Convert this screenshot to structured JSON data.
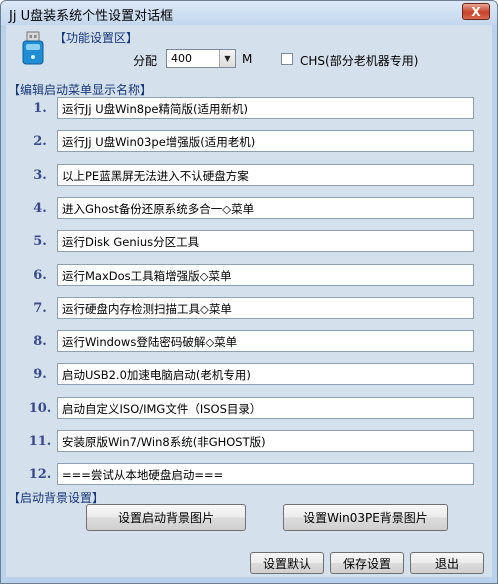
{
  "window": {
    "title": "Jj U盘装系统个性设置对话框",
    "close_glyph": "X"
  },
  "function_area": {
    "title": "【功能设置区】",
    "alloc_label": "分配",
    "alloc_value": "400",
    "alloc_unit": "M",
    "chs_label": "CHS(部分老机器专用)",
    "chs_checked": false
  },
  "menu_section": {
    "title": "【编辑启动菜单显示名称】",
    "items": [
      {
        "num": "1.",
        "text": "运行Jj U盘Win8pe精简版(适用新机)"
      },
      {
        "num": "2.",
        "text": "运行Jj U盘Win03pe增强版(适用老机)"
      },
      {
        "num": "3.",
        "text": "以上PE蓝黑屏无法进入不认硬盘方案"
      },
      {
        "num": "4.",
        "text": "进入Ghost备份还原系统多合一◇菜单"
      },
      {
        "num": "5.",
        "text": "运行Disk Genius分区工具"
      },
      {
        "num": "6.",
        "text": "运行MaxDos工具箱增强版◇菜单"
      },
      {
        "num": "7.",
        "text": "运行硬盘内存检测扫描工具◇菜单"
      },
      {
        "num": "8.",
        "text": "运行Windows登陆密码破解◇菜单"
      },
      {
        "num": "9.",
        "text": "启动USB2.0加速电脑启动(老机专用)"
      },
      {
        "num": "10.",
        "text": "启动自定义ISO/IMG文件（ISOS目录）"
      },
      {
        "num": "11.",
        "text": "安装原版Win7/Win8系统(非GHOST版)"
      },
      {
        "num": "12.",
        "text": "===尝试从本地硬盘启动==="
      }
    ]
  },
  "background_section": {
    "title": "【启动背景设置】",
    "set_boot_bg": "设置启动背景图片",
    "set_win03pe_bg": "设置Win03PE背景图片"
  },
  "footer": {
    "default_btn": "设置默认",
    "save_btn": "保存设置",
    "exit_btn": "退出"
  },
  "colors": {
    "client_bg": "#d4e0ec",
    "section_title": "#17377a",
    "number": "#3a4a8a"
  }
}
